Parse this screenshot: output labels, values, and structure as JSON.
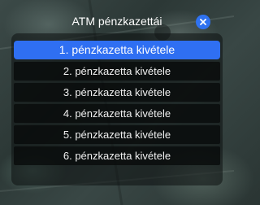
{
  "dialog": {
    "title": "ATM pénzkazettái",
    "close_icon": "close-icon",
    "accent_color": "#2f6ff2"
  },
  "menu": {
    "selected_index": 0,
    "items": [
      {
        "label": "1. pénzkazetta kivétele"
      },
      {
        "label": "2. pénzkazetta kivétele"
      },
      {
        "label": "3. pénzkazetta kivétele"
      },
      {
        "label": "4. pénzkazetta kivétele"
      },
      {
        "label": "5. pénzkazetta kivétele"
      },
      {
        "label": "6. pénzkazetta kivétele"
      }
    ]
  }
}
